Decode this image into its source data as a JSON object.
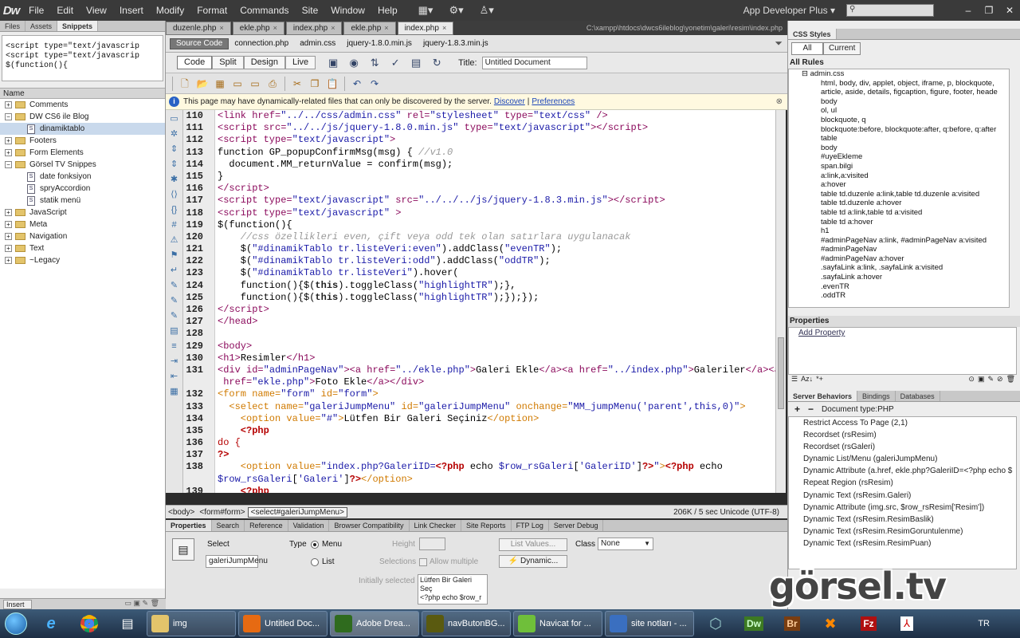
{
  "app": {
    "logo": "Dw",
    "menu": [
      "File",
      "Edit",
      "View",
      "Insert",
      "Modify",
      "Format",
      "Commands",
      "Site",
      "Window",
      "Help"
    ],
    "workspace": "App Developer Plus",
    "window_controls": [
      "–",
      "❐",
      "✕"
    ]
  },
  "left_panel": {
    "tabs": [
      "Files",
      "Assets",
      "Snippets"
    ],
    "active_tab": "Snippets",
    "preview": "<script type=\"text/javascrip\n<script type=\"text/javascrip\n$(function(){",
    "tree_header": "Name",
    "tree": [
      {
        "label": "Comments",
        "level": 0,
        "type": "folder",
        "expanded": false
      },
      {
        "label": "DW CS6 ile Blog",
        "level": 0,
        "type": "folder",
        "expanded": true
      },
      {
        "label": "dinamiktablo",
        "level": 1,
        "type": "file",
        "selected": true
      },
      {
        "label": "Footers",
        "level": 0,
        "type": "folder",
        "expanded": false
      },
      {
        "label": "Form Elements",
        "level": 0,
        "type": "folder",
        "expanded": false
      },
      {
        "label": "Görsel TV Snippes",
        "level": 0,
        "type": "folder",
        "expanded": true
      },
      {
        "label": "date fonksiyon",
        "level": 1,
        "type": "file"
      },
      {
        "label": "spryAccordion",
        "level": 1,
        "type": "file"
      },
      {
        "label": "statik menü",
        "level": 1,
        "type": "file"
      },
      {
        "label": "JavaScript",
        "level": 0,
        "type": "folder",
        "expanded": false
      },
      {
        "label": "Meta",
        "level": 0,
        "type": "folder",
        "expanded": false
      },
      {
        "label": "Navigation",
        "level": 0,
        "type": "folder",
        "expanded": false
      },
      {
        "label": "Text",
        "level": 0,
        "type": "folder",
        "expanded": false
      },
      {
        "label": "~Legacy",
        "level": 0,
        "type": "folder",
        "expanded": false
      }
    ],
    "footer_tab": "Insert"
  },
  "doc_tabs": [
    {
      "label": "duzenle.php",
      "active": false
    },
    {
      "label": "ekle.php",
      "active": false
    },
    {
      "label": "index.php",
      "active": false
    },
    {
      "label": "ekle.php",
      "active": false
    },
    {
      "label": "index.php",
      "active": true
    }
  ],
  "doc_path": "C:\\xampp\\htdocs\\dwcs6ileblog\\yonetim\\galeri\\resim\\index.php",
  "related_files": [
    "Source Code",
    "connection.php",
    "admin.css",
    "jquery-1.8.0.min.js",
    "jquery-1.8.3.min.js"
  ],
  "doc_toolbar": {
    "views": [
      "Code",
      "Split",
      "Design",
      "Live"
    ],
    "active_view": "Code",
    "title_label": "Title:",
    "title_value": "Untitled Document"
  },
  "info_bar": {
    "text": "This page may have dynamically-related files that can only be discovered by the server.",
    "link1": "Discover",
    "link2": "Preferences"
  },
  "code": {
    "line_numbers": [
      "110",
      "111",
      "112",
      "113",
      "114",
      "115",
      "116",
      "117",
      "118",
      "119",
      "120",
      "121",
      "122",
      "123",
      "124",
      "125",
      "126",
      "127",
      "128",
      "129",
      "130",
      "131",
      "",
      "132",
      "133",
      "134",
      "135",
      "136",
      "137",
      "138",
      "",
      "139"
    ]
  },
  "status_bar": {
    "tags": [
      "<body>",
      "<form#form>",
      "<select#galeriJumpMenu>"
    ],
    "stats": "206K / 5 sec  Unicode (UTF-8)"
  },
  "properties": {
    "tabs": [
      "Properties",
      "Search",
      "Reference",
      "Validation",
      "Browser Compatibility",
      "Link Checker",
      "Site Reports",
      "FTP Log",
      "Server Debug"
    ],
    "select_label": "Select",
    "select_name": "galeriJumpMenu",
    "type_label": "Type",
    "type_menu": "Menu",
    "type_list": "List",
    "height_label": "Height",
    "selections_label": "Selections",
    "allow_multiple": "Allow multiple",
    "list_values_btn": "List Values...",
    "dynamic_btn": "Dynamic...",
    "class_label": "Class",
    "class_value": "None",
    "initially_selected": "Initially selected",
    "initial_items": [
      "Lütfen Bir Galeri Seç",
      "<?php echo $row_r"
    ]
  },
  "right_panel": {
    "css_tab": "CSS Styles",
    "css_buttons": [
      "All",
      "Current"
    ],
    "rules_head": "All Rules",
    "rules_root": "admin.css",
    "rules": [
      "html, body, div, applet, object, iframe, p, blockquote,",
      "article, aside, details, figcaption, figure, footer, heade",
      "body",
      "ol, ul",
      "blockquote, q",
      "blockquote:before, blockquote:after, q:before, q:after",
      "table",
      "body",
      "#uyeEkleme",
      "span.bilgi",
      "a:link,a:visited",
      "a:hover",
      "table td.duzenle a:link,table td.duzenle a:visited",
      "table td.duzenle a:hover",
      "table td a:link,table td a:visited",
      "table td a:hover",
      "h1",
      "#adminPageNav a:link, #adminPageNav a:visited",
      "#adminPageNav",
      "#adminPageNav a:hover",
      ".sayfaLink a:link, .sayfaLink a:visited",
      ".sayfaLink a:hover",
      ".evenTR",
      ".oddTR"
    ],
    "properties_head": "Properties",
    "add_property": "Add Property",
    "sb_tabs": [
      "Server Behaviors",
      "Bindings",
      "Databases"
    ],
    "doc_type": "Document type:PHP",
    "behaviors": [
      "Restrict Access To Page (2,1)",
      "Recordset (rsResim)",
      "Recordset (rsGaleri)",
      "Dynamic List/Menu (galeriJumpMenu)",
      "Dynamic Attribute (a.href, ekle.php?GaleriID=<?php echo $",
      "Repeat Region (rsResim)",
      "Dynamic Text (rsResim.Galeri)",
      "Dynamic Attribute (img.src, $row_rsResim['Resim'])",
      "Dynamic Text (rsResim.ResimBaslik)",
      "Dynamic Text (rsResim.ResimGoruntulenme)",
      "Dynamic Text (rsResim.ResimPuan)"
    ]
  },
  "watermark": "görsel.tv",
  "taskbar": {
    "items": [
      {
        "label": "img",
        "icon": "folder-icon",
        "color": "#e3c46b"
      },
      {
        "label": "Untitled Doc...",
        "icon": "firefox-icon",
        "color": "#e66a12"
      },
      {
        "label": "Adobe Drea...",
        "icon": "dreamweaver-icon",
        "color": "#2f6b1e",
        "active": true
      },
      {
        "label": "navButonBG...",
        "icon": "fireworks-icon",
        "color": "#5a5a10"
      },
      {
        "label": "Navicat for ...",
        "icon": "navicat-icon",
        "color": "#6fbf3a"
      },
      {
        "label": "site notları - ...",
        "icon": "document-icon",
        "color": "#3a6fc0"
      }
    ],
    "tray": "TR"
  }
}
